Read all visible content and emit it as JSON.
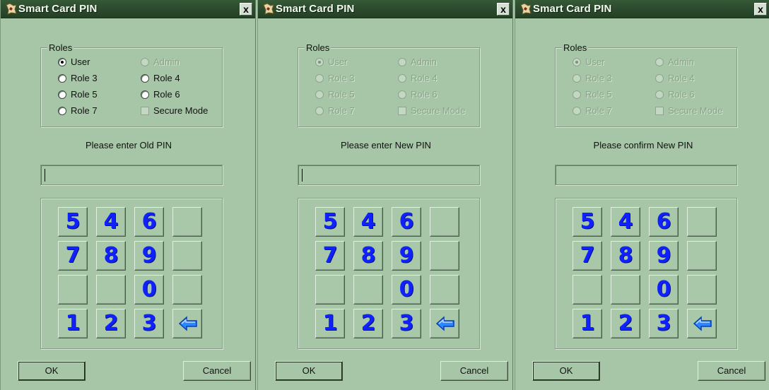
{
  "title": "Smart Card PIN",
  "close_label": "x",
  "roles": {
    "legend": "Roles",
    "user": "User",
    "admin": "Admin",
    "role3": "Role 3",
    "role4": "Role 4",
    "role5": "Role 5",
    "role6": "Role 6",
    "role7": "Role 7",
    "secure_mode": "Secure Mode"
  },
  "dialogs": [
    {
      "prompt": "Please enter Old PIN",
      "roles_enabled": true
    },
    {
      "prompt": "Please enter New PIN",
      "roles_enabled": false
    },
    {
      "prompt": "Please confirm New PIN",
      "roles_enabled": false
    }
  ],
  "keypad": {
    "rows": [
      [
        "5",
        "4",
        "6",
        ""
      ],
      [
        "7",
        "8",
        "9",
        ""
      ],
      [
        "",
        "",
        "0",
        ""
      ],
      [
        "1",
        "2",
        "3",
        "backspace"
      ]
    ]
  },
  "buttons": {
    "ok": "OK",
    "cancel": "Cancel"
  },
  "colors": {
    "window_bg": "#a6c6a7",
    "titlebar": "#2d4c2f",
    "key_text": "#0f21ff"
  },
  "icons": {
    "app": "app-icon",
    "close": "close-icon",
    "backspace": "backspace-icon"
  }
}
